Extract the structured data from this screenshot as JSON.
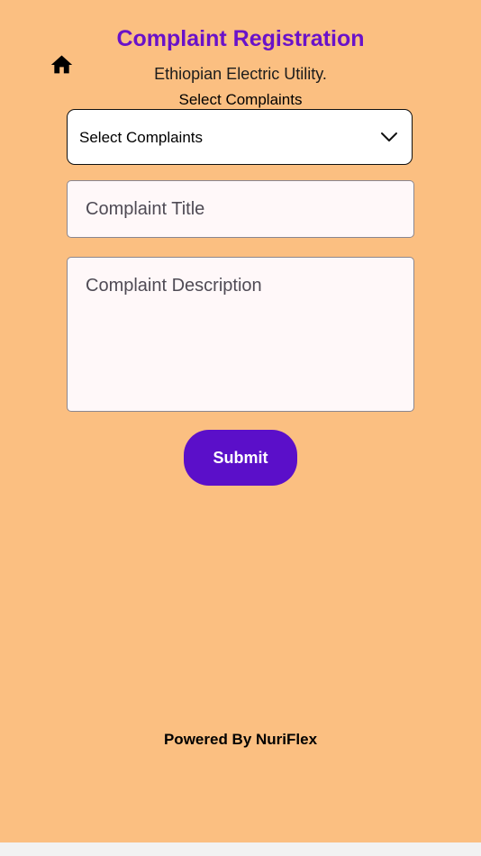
{
  "header": {
    "title": "Complaint Registration",
    "subtitle": "Ethiopian Electric Utility.",
    "home_icon": "home-icon"
  },
  "form": {
    "select_label": "Select Complaints",
    "select_value": "Select Complaints",
    "title_placeholder": "Complaint Title",
    "description_placeholder": "Complaint Description",
    "submit_label": "Submit"
  },
  "footer": {
    "text": "Powered By NuriFlex"
  },
  "colors": {
    "background": "#fbbf81",
    "title": "#6a12c9",
    "button": "#5b0fc9"
  }
}
